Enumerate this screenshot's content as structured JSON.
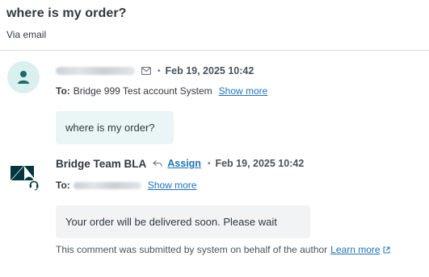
{
  "ticket": {
    "subject": "where is my order?",
    "channel": "Via email"
  },
  "messages": [
    {
      "author_redacted": true,
      "channel_icon": "envelope-icon",
      "separator": "•",
      "timestamp": "Feb 19, 2025 10:42",
      "to_label": "To:",
      "to_value": "Bridge 999 Test account System",
      "show_more": "Show more",
      "body": "where is my order?",
      "avatar_icon": "user-icon"
    },
    {
      "author": "Bridge Team BLA",
      "reply_icon": "reply-icon",
      "assign_label": "Assign",
      "separator": "•",
      "timestamp": "Feb 19, 2025 10:42",
      "to_label": "To:",
      "to_value_redacted": true,
      "show_more": "Show more",
      "body": "Your order will be delivered soon. Please wait",
      "avatar_icon": "zendesk-logo-icon",
      "system_note": "This comment was submitted by system on behalf of the author",
      "learn_more": "Learn more",
      "learn_more_icon": "external-link-icon"
    }
  ],
  "colors": {
    "link": "#1f73b7",
    "customer_bubble": "#e9f6f5",
    "agent_bubble": "#f2f3f4",
    "avatar_bg": "#d9f0ef",
    "divider": "#d8dcde"
  }
}
